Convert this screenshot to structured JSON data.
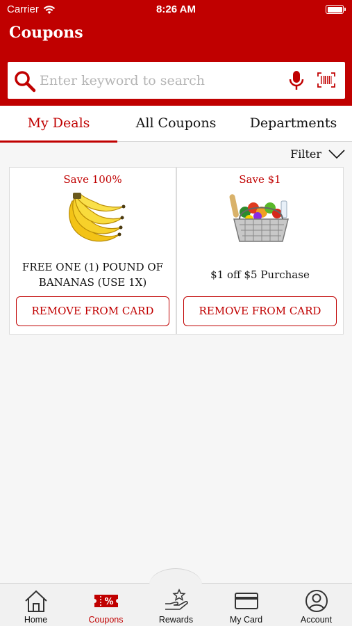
{
  "status_bar": {
    "carrier": "Carrier",
    "time": "8:26 AM"
  },
  "header": {
    "title": "Coupons"
  },
  "search": {
    "placeholder": "Enter keyword to search"
  },
  "tabs": [
    {
      "label": "My Deals",
      "active": true
    },
    {
      "label": "All Coupons",
      "active": false
    },
    {
      "label": "Departments",
      "active": false
    }
  ],
  "filter": {
    "label": "Filter"
  },
  "coupons": [
    {
      "save_label": "Save 100%",
      "title_line1": "FREE ONE (1) POUND OF",
      "title_line2": "BANANAS (USE 1X)",
      "button_label": "REMOVE FROM CARD",
      "image": "bananas"
    },
    {
      "save_label": "Save $1",
      "title_line1": "$1 off $5 Purchase",
      "title_line2": "",
      "button_label": "REMOVE FROM CARD",
      "image": "grocery-basket"
    }
  ],
  "bottom_nav": [
    {
      "label": "Home",
      "icon": "home-icon",
      "active": false
    },
    {
      "label": "Coupons",
      "icon": "coupon-icon",
      "active": true
    },
    {
      "label": "Rewards",
      "icon": "rewards-icon",
      "active": false
    },
    {
      "label": "My Card",
      "icon": "card-icon",
      "active": false
    },
    {
      "label": "Account",
      "icon": "account-icon",
      "active": false
    }
  ],
  "colors": {
    "brand": "#c00000",
    "background": "#f6f6f6",
    "nav_background": "#f1f1f1"
  }
}
